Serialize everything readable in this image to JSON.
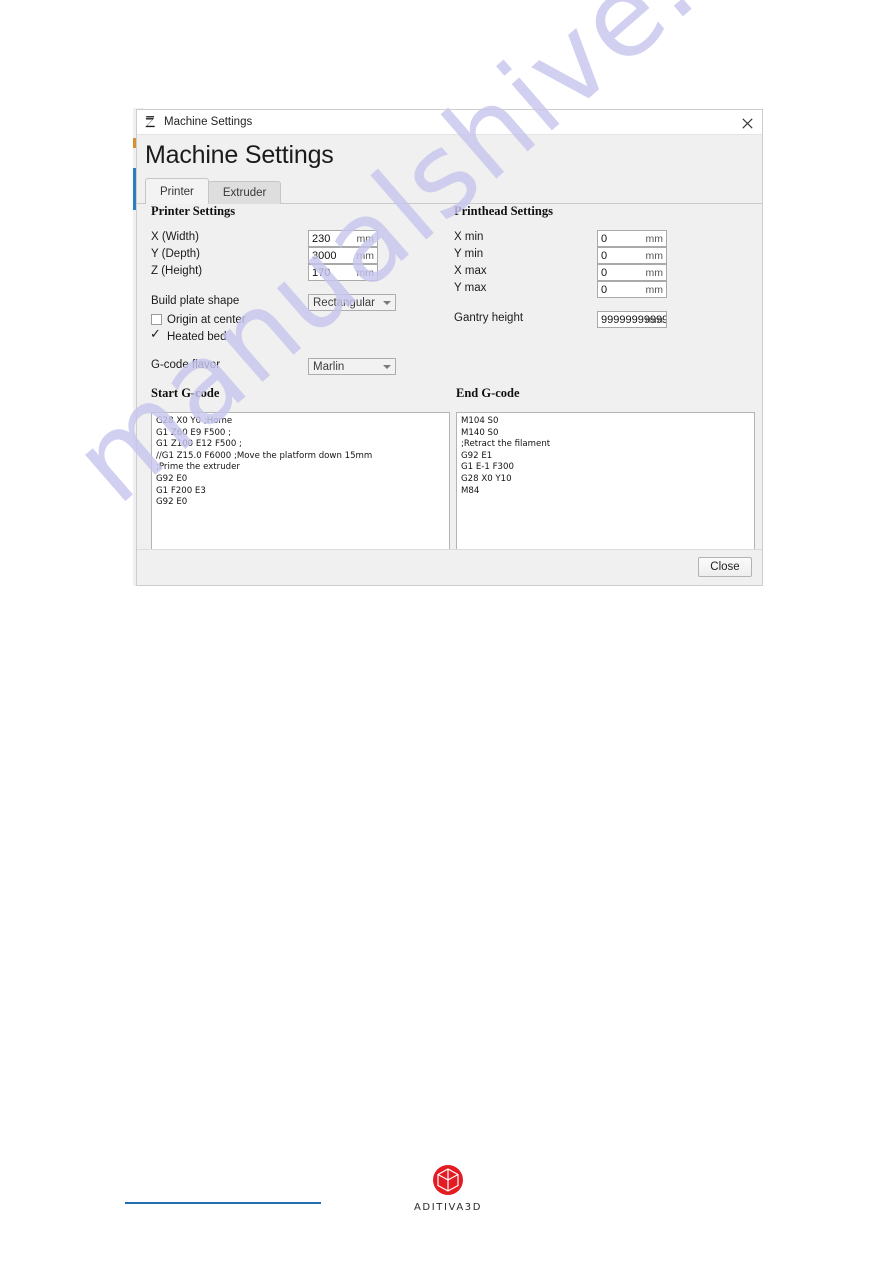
{
  "window": {
    "icon": "zortrax-z-icon",
    "title": "Machine Settings",
    "close_label": "✕"
  },
  "header": {
    "title": "Machine Settings"
  },
  "tabs": [
    {
      "label": "Printer",
      "active": true
    },
    {
      "label": "Extruder",
      "active": false
    }
  ],
  "printer_settings": {
    "section_title": "Printer Settings",
    "unit": "mm",
    "fields": [
      {
        "label": "X (Width)",
        "value": "230"
      },
      {
        "label": "Y (Depth)",
        "value": "3000"
      },
      {
        "label": "Z (Height)",
        "value": "170"
      }
    ],
    "build_plate_shape": {
      "label": "Build plate shape",
      "value": "Rectangular"
    },
    "origin_at_center": {
      "label": "Origin at center",
      "checked": false
    },
    "heated_bed": {
      "label": "Heated bed",
      "checked": true
    },
    "gcode_flavor": {
      "label": "G-code flavor",
      "value": "Marlin"
    }
  },
  "printhead_settings": {
    "section_title": "Printhead Settings",
    "unit": "mm",
    "fields": [
      {
        "label": "X min",
        "value": "0"
      },
      {
        "label": "Y min",
        "value": "0"
      },
      {
        "label": "X max",
        "value": "0"
      },
      {
        "label": "Y max",
        "value": "0"
      }
    ],
    "gantry_height": {
      "label": "Gantry height",
      "value": "99999999999"
    }
  },
  "start_gcode": {
    "title": "Start G-code",
    "text": "G28 X0 Y0 ;Home\nG1 Z60 E9 F500 ;\nG1 Z100 E12 F500 ;\n//G1 Z15.0 F6000 ;Move the platform down 15mm\n;Prime the extruder\nG92 E0\nG1 F200 E3\nG92 E0"
  },
  "end_gcode": {
    "title": "End G-code",
    "text": "M104 S0\nM140 S0\n;Retract the filament\nG92 E1\nG1 E-1 F300\nG28 X0 Y10\nM84"
  },
  "footer": {
    "close_button": "Close"
  },
  "page": {
    "watermark": "manualshive.com",
    "brand_name": "ADITIVA3D",
    "brand_color": "#e31b23",
    "rule_color": "#1f6fb2"
  }
}
